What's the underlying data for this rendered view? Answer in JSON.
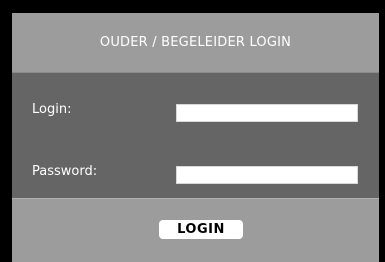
{
  "header": {
    "title": "OUDER / BEGELEIDER LOGIN"
  },
  "form": {
    "login_label": "Login:",
    "login_value": "",
    "password_label": "Password:",
    "password_value": ""
  },
  "footer": {
    "login_button_label": "LOGIN"
  },
  "colors": {
    "page_background": "#000000",
    "header_background": "#9c9c9c",
    "form_background": "#656565",
    "footer_background": "#9c9c9c",
    "field_background": "#ffffff"
  }
}
